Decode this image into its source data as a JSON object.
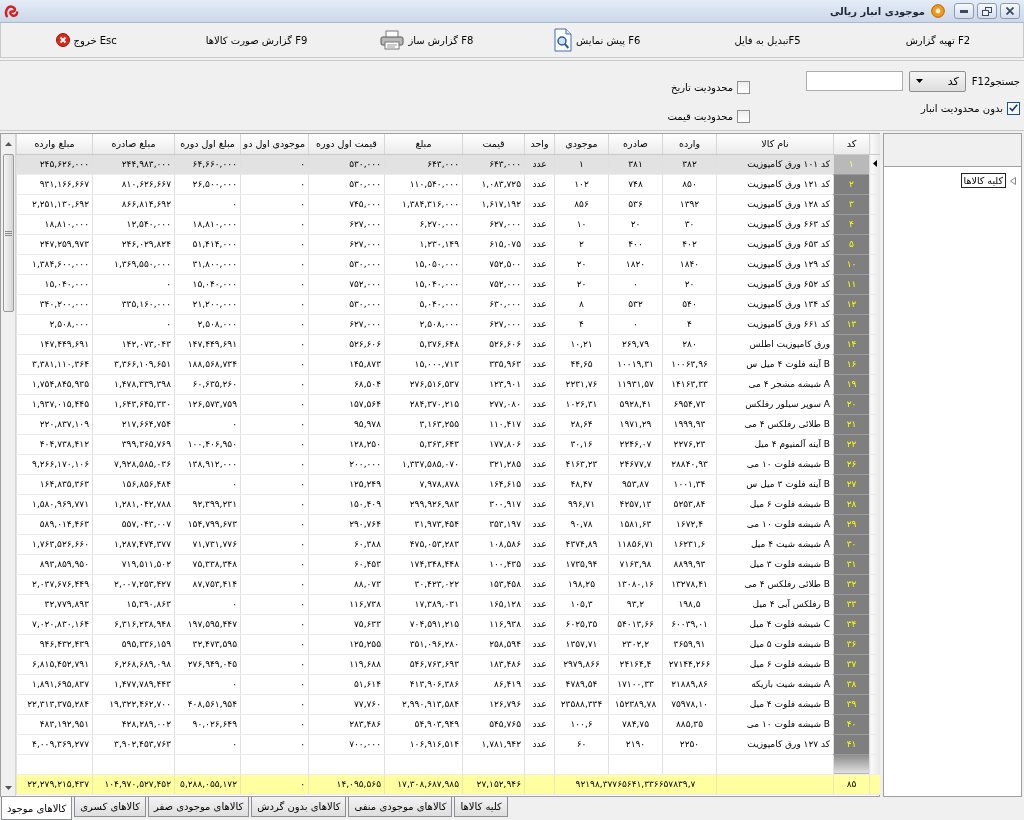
{
  "window": {
    "title": "موجودی انبار ریالی"
  },
  "toolbar": [
    {
      "label": "تهیه گزارش F2",
      "kind": "plain"
    },
    {
      "label": "تبدیل به فایلF5",
      "kind": "plain"
    },
    {
      "label": "پیش نمایش F6",
      "kind": "preview"
    },
    {
      "label": "گزارش ساز F8",
      "kind": "print"
    },
    {
      "label": "گزارش صورت کالاها F9",
      "kind": "plain"
    },
    {
      "label": "خروج Esc",
      "kind": "exit"
    }
  ],
  "filters": {
    "search": {
      "label": "F12جستجو",
      "field": "کد"
    },
    "warehouse": {
      "label": "بدون محدودیت انبار",
      "checked": true
    },
    "limits": [
      {
        "label": "محدودیت تاریخ",
        "checked": false
      },
      {
        "label": "محدودیت قیمت",
        "checked": false
      }
    ]
  },
  "table": {
    "columns": [
      "کد",
      "نام کالا",
      "وارده",
      "صادره",
      "موجودی",
      "واحد",
      "قیمت",
      "مبلغ",
      "قیمت اول دوره",
      "موجودی اول دو",
      "مبلغ اول دوره",
      "مبلغ صادره",
      "مبلغ وارده"
    ],
    "rows": [
      {
        "selected": true,
        "cells": [
          "۱",
          "کد ۱۰۱ ورق کامپوزیت",
          "۳۸۲",
          "۳۸۱",
          "۱",
          "عدد",
          "۶۴۳,۰۰۰",
          "۶۴۳,۰۰۰",
          "۵۳۰,۰۰۰",
          "۰",
          "۶۴,۶۶۰,۰۰۰",
          "۲۴۴,۹۸۳,۰۰۰",
          "۲۴۵,۶۲۶,۰۰۰"
        ]
      },
      {
        "selected": false,
        "cells": [
          "۲",
          "کد ۱۲۱ ورق کامپوزیت",
          "۸۵۰",
          "۷۴۸",
          "۱۰۲",
          "عدد",
          "۱,۰۸۳,۷۲۵",
          "۱۱۰,۵۴۰,۰۰۰",
          "۵۳۰,۰۰۰",
          "۰",
          "۲۶,۵۰۰,۰۰۰",
          "۸۱۰,۶۲۶,۶۶۷",
          "۹۳۱,۱۶۶,۶۶۷"
        ]
      },
      {
        "selected": false,
        "cells": [
          "۳",
          "کد ۱۲۸ ورق کامپوزیت",
          "۱۳۹۲",
          "۵۳۶",
          "۸۵۶",
          "عدد",
          "۱,۶۱۷,۱۹۲",
          "۱,۳۸۴,۳۱۶,۰۰۰",
          "۷۴۵,۰۰۰",
          "۰",
          "۰",
          "۸۶۶,۸۱۴,۶۹۲",
          "۲,۲۵۱,۱۳۰,۶۹۲"
        ]
      },
      {
        "selected": false,
        "cells": [
          "۴",
          "کد ۶۶۳ ورق کامپوزیت",
          "۳۰",
          "۲۰",
          "۱۰",
          "عدد",
          "۶۲۷,۰۰۰",
          "۶,۲۷۰,۰۰۰",
          "۶۲۷,۰۰۰",
          "۰",
          "۱۸,۸۱۰,۰۰۰",
          "۱۲,۵۴۰,۰۰۰",
          "۱۸,۸۱۰,۰۰۰"
        ]
      },
      {
        "selected": false,
        "cells": [
          "۵",
          "کد ۶۵۳ ورق کامپوزیت",
          "۴۰۲",
          "۴۰۰",
          "۲",
          "عدد",
          "۶۱۵,۰۷۵",
          "۱,۲۳۰,۱۴۹",
          "۶۲۷,۰۰۰",
          "۰",
          "۵۱,۴۱۴,۰۰۰",
          "۲۴۶,۰۲۹,۸۲۴",
          "۲۴۷,۲۵۹,۹۷۳"
        ]
      },
      {
        "selected": false,
        "cells": [
          "۱۰",
          "کد ۱۲۹ ورق کامپوزیت",
          "۱۸۴۰",
          "۱۸۲۰",
          "۲۰",
          "عدد",
          "۷۵۲,۵۰۰",
          "۱۵,۰۵۰,۰۰۰",
          "۵۳۰,۰۰۰",
          "۰",
          "۳۱,۸۰۰,۰۰۰",
          "۱,۳۶۹,۵۵۰,۰۰۰",
          "۱,۳۸۴,۶۰۰,۰۰۰"
        ]
      },
      {
        "selected": false,
        "cells": [
          "۱۱",
          "کد ۶۵۲ ورق کامپوزیت",
          "۲۰",
          "۰",
          "۲۰",
          "عدد",
          "۷۵۲,۰۰۰",
          "۱۵,۰۴۰,۰۰۰",
          "۷۵۲,۰۰۰",
          "۰",
          "۱۵,۰۴۰,۰۰۰",
          "۰",
          "۱۵,۰۴۰,۰۰۰"
        ]
      },
      {
        "selected": false,
        "cells": [
          "۱۲",
          "کد ۱۳۴ ورق کامپوزیت",
          "۵۴۰",
          "۵۳۲",
          "۸",
          "عدد",
          "۶۳۰,۰۰۰",
          "۵,۰۴۰,۰۰۰",
          "۵۳۰,۰۰۰",
          "۰",
          "۲۱,۲۰۰,۰۰۰",
          "۳۳۵,۱۶۰,۰۰۰",
          "۳۴۰,۲۰۰,۰۰۰"
        ]
      },
      {
        "selected": false,
        "cells": [
          "۱۳",
          "کد ۶۶۱ ورق کامپوزیت",
          "۴",
          "۰",
          "۴",
          "عدد",
          "۶۲۷,۰۰۰",
          "۲,۵۰۸,۰۰۰",
          "۶۲۷,۰۰۰",
          "۰",
          "۲,۵۰۸,۰۰۰",
          "۰",
          "۲,۵۰۸,۰۰۰"
        ]
      },
      {
        "selected": false,
        "cells": [
          "۱۴",
          "ورق کامپوزیت اطلس",
          "۲۸۰",
          "۲۶۹,۷۹",
          "۱۰,۲۱",
          "عدد",
          "۵۲۶,۶۰۶",
          "۵,۳۷۶,۶۴۸",
          "۵۲۶,۶۰۶",
          "۰",
          "۱۴۷,۴۴۹,۶۹۱",
          "۱۴۲,۰۷۳,۰۴۳",
          "۱۴۷,۴۴۹,۶۹۱"
        ]
      },
      {
        "selected": false,
        "cells": [
          "۱۶",
          "B آینه فلوت ۴ میل س",
          "۱۰۰۶۳,۹۶",
          "۱۰۰۱۹,۳۱",
          "۴۴,۶۵",
          "عدد",
          "۳۳۵,۹۶۳",
          "۱۵,۰۰۰,۷۱۳",
          "۱۴۵,۸۷۳",
          "۰",
          "۱۸۸,۵۶۸,۷۳۴",
          "۳,۳۶۶,۱۰۹,۶۵۱",
          "۳,۳۸۱,۱۱۰,۳۶۴"
        ]
      },
      {
        "selected": false,
        "cells": [
          "۱۹",
          "A شیشه مشجر ۴ می",
          "۱۴۱۶۳,۳۳",
          "۱۱۹۳۱,۵۷",
          "۲۲۳۱,۷۶",
          "عدد",
          "۱۲۳,۹۰۱",
          "۲۷۶,۵۱۶,۵۳۷",
          "۶۸,۵۰۴",
          "۰",
          "۶۰,۶۳۵,۲۶۰",
          "۱,۴۷۸,۳۳۹,۳۹۸",
          "۱,۷۵۴,۸۴۵,۹۳۵"
        ]
      },
      {
        "selected": false,
        "cells": [
          "۲۰",
          "A سوپر سیلور رفلکس",
          "۶۹۵۴,۷۳",
          "۵۹۲۸,۴۱",
          "۱۰۲۶,۳۱",
          "عدد",
          "۲۷۷,۰۸۰",
          "۲۸۴,۳۷۰,۲۱۵",
          "۱۵۷,۵۶۴",
          "۰",
          "۱۲۶,۵۷۳,۷۵۹",
          "۱,۶۴۳,۶۴۵,۳۳۰",
          "۱,۹۳۷,۰۱۵,۴۴۵"
        ]
      },
      {
        "selected": false,
        "cells": [
          "۲۱",
          "B طلائی رفلکس ۴ می",
          "۱۹۹۹,۹۳",
          "۱۹۷۱,۲۹",
          "۲۸,۶۴",
          "عدد",
          "۱۱۰,۴۱۷",
          "۳,۱۶۳,۲۵۵",
          "۹۵,۹۷۸",
          "۰",
          "۰",
          "۲۱۷,۶۶۴,۷۵۴",
          "۲۲۰,۸۳۷,۱۰۹"
        ]
      },
      {
        "selected": false,
        "cells": [
          "۲۲",
          "B آینه آلمنیوم ۴ میل",
          "۲۲۷۶,۲۳",
          "۲۲۴۶,۰۷",
          "۳۰,۱۶",
          "عدد",
          "۱۷۷,۸۰۶",
          "۵,۳۶۳,۶۴۳",
          "۱۲۸,۲۵۰",
          "۰",
          "۱۰۰,۴۰۶,۹۵۰",
          "۳۹۹,۳۶۵,۷۶۹",
          "۴۰۴,۷۳۸,۴۱۲"
        ]
      },
      {
        "selected": false,
        "cells": [
          "۲۶",
          "B شیشه فلوت ۱۰ می",
          "۲۸۸۴۰,۹۳",
          "۲۴۶۷۷,۷",
          "۴۱۶۳,۲۳",
          "عدد",
          "۳۲۱,۲۸۵",
          "۱,۳۳۷,۵۸۵,۰۷۰",
          "۲۰۰,۰۰۰",
          "۰",
          "۱۳۸,۹۱۲,۰۰۰",
          "۷,۹۲۸,۵۸۵,۰۳۶",
          "۹,۲۶۶,۱۷۰,۱۰۶"
        ]
      },
      {
        "selected": false,
        "cells": [
          "۲۷",
          "B آینه فلوت ۳ میل س",
          "۱۰۰۱,۳۴",
          "۹۵۳,۸۷",
          "۴۸,۴۷",
          "عدد",
          "۱۶۴,۶۱۵",
          "۷,۹۷۸,۸۷۸",
          "۱۲۵,۲۴۹",
          "۰",
          "۰",
          "۱۵۶,۸۵۶,۴۸۴",
          "۱۶۴,۸۳۵,۳۶۳"
        ]
      },
      {
        "selected": false,
        "cells": [
          "۲۸",
          "B شیشه فلوت ۶ میل",
          "۵۲۵۳,۸۴",
          "۴۲۵۷,۱۳",
          "۹۹۶,۷۱",
          "عدد",
          "۳۰۰,۹۱۷",
          "۲۹۹,۹۲۶,۹۸۳",
          "۱۵۰,۴۰۹",
          "۰",
          "۹۲,۳۹۹,۲۳۱",
          "۱,۲۸۱,۰۴۲,۷۸۸",
          "۱,۵۸۰,۹۶۹,۷۷۱"
        ]
      },
      {
        "selected": false,
        "cells": [
          "۲۹",
          "A شیشه فلوت ۱۰ می",
          "۱۶۷۲,۴",
          "۱۵۸۱,۶۳",
          "۹۰,۷۸",
          "عدد",
          "۳۵۳,۱۹۷",
          "۳۱,۹۷۳,۴۵۴",
          "۲۹۰,۷۶۴",
          "۰",
          "۱۵۴,۷۹۹,۶۷۳",
          "۵۵۷,۰۴۳,۰۰۷",
          "۵۸۹,۰۱۴,۴۶۳"
        ]
      },
      {
        "selected": false,
        "cells": [
          "۳۰",
          "A شیشه شیت ۴ میل",
          "۱۶۲۳۱,۶",
          "۱۱۸۵۶,۷۱",
          "۴۳۷۴,۸۹",
          "عدد",
          "۱۰۸,۵۸۶",
          "۴۷۵,۰۵۳,۲۸۳",
          "۶۰,۳۸۸",
          "۰",
          "۷۱,۷۳۱,۷۷۶",
          "۱,۲۸۷,۴۷۴,۳۷۷",
          "۱,۷۶۳,۵۲۶,۶۶۰"
        ]
      },
      {
        "selected": false,
        "cells": [
          "۳۱",
          "B شیشه فلوت ۳ میل",
          "۸۸۹۹,۹۳",
          "۷۱۶۳,۹۸",
          "۱۷۳۵,۹۴",
          "عدد",
          "۱۰۰,۴۳۵",
          "۱۷۴,۳۴۸,۴۴۸",
          "۶۰,۴۵۳",
          "۰",
          "۷۵,۳۳۸,۳۴۸",
          "۷۱۹,۵۱۱,۵۰۲",
          "۸۹۳,۸۵۹,۹۵۰"
        ]
      },
      {
        "selected": false,
        "cells": [
          "۳۲",
          "B طلائی رفلکس ۴ می",
          "۱۳۲۷۸,۴۱",
          "۱۳۰۸۰,۱۶",
          "۱۹۸,۲۵",
          "عدد",
          "۱۵۳,۴۵۸",
          "۳۰,۴۲۳,۰۲۲",
          "۸۸,۰۷۳",
          "۰",
          "۸۷,۷۵۳,۴۱۴",
          "۲,۰۰۷,۲۵۳,۴۲۷",
          "۲,۰۳۷,۶۷۶,۴۴۹"
        ]
      },
      {
        "selected": false,
        "cells": [
          "۳۳",
          "B رفلکس آبی ۴ میل",
          "۱۹۸,۵",
          "۹۳,۲",
          "۱۰۵,۳",
          "عدد",
          "۱۶۵,۱۲۸",
          "۱۷,۳۸۹,۰۳۱",
          "۱۱۶,۷۳۸",
          "۰",
          "۰",
          "۱۵,۳۹۰,۸۶۳",
          "۳۲,۷۷۹,۸۹۳"
        ]
      },
      {
        "selected": false,
        "cells": [
          "۳۴",
          "C شیشه فلوت ۴ میل",
          "۶۰۰۳۹,۰۱",
          "۵۴۰۱۳,۶۶",
          "۶۰۲۵,۳۵",
          "عدد",
          "۱۱۶,۹۳۸",
          "۷۰۴,۵۹۱,۲۱۵",
          "۷۵,۶۳۳",
          "۰",
          "۱۹۷,۵۹۵,۴۴۷",
          "۶,۳۱۶,۲۳۸,۹۴۸",
          "۷,۰۲۰,۸۳۰,۱۶۴"
        ]
      },
      {
        "selected": false,
        "cells": [
          "۳۶",
          "B شیشه فلوت ۵ میل",
          "۳۶۵۹,۹۱",
          "۲۳۰۲,۲",
          "۱۳۵۷,۷۱",
          "عدد",
          "۲۵۸,۵۹۴",
          "۳۵۱,۰۹۶,۲۸۰",
          "۱۲۵,۲۵۵",
          "۰",
          "۳۲,۴۷۳,۵۹۵",
          "۵۹۵,۳۳۶,۱۵۹",
          "۹۴۶,۴۳۲,۴۳۹"
        ]
      },
      {
        "selected": false,
        "cells": [
          "۳۷",
          "B شیشه فلوت ۶ میل",
          "۲۷۱۴۴,۲۶۶",
          "۲۴۱۶۴,۴",
          "۲۹۷۹,۸۶۶",
          "عدد",
          "۱۸۳,۴۸۶",
          "۵۴۶,۷۶۳,۶۹۳",
          "۱۱۹,۶۸۸",
          "۰",
          "۲۷۶,۹۴۹,۰۴۵",
          "۶,۲۶۸,۶۸۹,۰۹۸",
          "۶,۸۱۵,۴۵۲,۷۹۱"
        ]
      },
      {
        "selected": false,
        "cells": [
          "۳۸",
          "A شیشه شیت باریکه",
          "۲۱۸۸۹,۸۶",
          "۱۷۱۰۰,۳۳",
          "۴۷۸۹,۵۴",
          "عدد",
          "۸۶,۴۱۹",
          "۴۱۳,۹۰۶,۳۸۶",
          "۵۱,۶۱۴",
          "۰",
          "۰",
          "۱,۴۷۷,۷۸۹,۴۴۳",
          "۱,۸۹۱,۶۹۵,۸۳۷"
        ]
      },
      {
        "selected": false,
        "cells": [
          "۳۹",
          "B شیشه فلوت ۴ میل",
          "۷۵۹۷۸,۱۰",
          "۱۵۲۳۸۹,۷۸",
          "۲۳۵۸۸,۳۳۴",
          "عدد",
          "۱۲۶,۷۹۶",
          "۲,۹۹۰,۹۱۳,۵۸۴",
          "۷۷,۷۶۰",
          "۰",
          "۴۰۸,۵۶۱,۹۵۴",
          "۱۹,۳۲۲,۴۶۲,۷۰۰",
          "۲۲,۳۱۳,۳۷۵,۲۸۴"
        ]
      },
      {
        "selected": false,
        "cells": [
          "۴۰",
          "B شیشه فلوت ۱۰ می",
          "۸۸۵,۳۵",
          "۷۸۴,۷۵",
          "۱۰۰,۶",
          "عدد",
          "۵۴۵,۷۶۵",
          "۵۴,۹۰۳,۹۴۹",
          "۲۸۳,۴۸۶",
          "۰",
          "۹۰,۰۲۶,۶۴۹",
          "۴۲۸,۲۸۹,۰۰۲",
          "۴۸۳,۱۹۲,۹۵۱"
        ]
      },
      {
        "selected": false,
        "cells": [
          "۴۱",
          "کد ۱۲۷ ورق کامپوزیت",
          "۲۲۵۰",
          "۲۱۹۰",
          "۶۰",
          "عدد",
          "۱,۷۸۱,۹۴۲",
          "۱۰۶,۹۱۶,۵۱۴",
          "۷۰۰,۰۰۰",
          "۰",
          "۰",
          "۳,۹۰۲,۴۵۳,۷۶۳",
          "۴,۰۰۹,۳۶۹,۲۷۷"
        ]
      }
    ],
    "totals": {
      "code": "۸۵",
      "quantities": "۹۲۱۹۸,۳۷۷۶۵۶۴۱,۳۳۶۶۵۷۸۳۹,۷",
      "price": "۲۷,۱۵۲,۹۴۶",
      "amount": "۱۷,۳۰۸,۶۸۷,۹۸۵",
      "opening_price": "۱۴,۰۹۵,۵۶۵",
      "opening_stock": "۰",
      "opening_amount": "۵,۲۸۸,۰۵۵,۱۷۲",
      "issued_amount": "۱۰۴,۹۷۰,۵۲۷,۴۵۲",
      "received_amount": "۲۲,۲۷۹,۲۱۵,۴۳۷"
    }
  },
  "tree": {
    "items": [
      {
        "label": "کلیه کالاها",
        "selected": true,
        "expanded": false
      }
    ]
  },
  "tabs": [
    {
      "label": "کلیه کالاها",
      "selected": false
    },
    {
      "label": "کالاهای موجودی منفی",
      "selected": false
    },
    {
      "label": "کالاهای بدون گردش",
      "selected": false
    },
    {
      "label": "کالاهای موجودی صفر",
      "selected": false
    },
    {
      "label": "کالاهای کسری",
      "selected": false
    },
    {
      "label": "کالاهای موجود",
      "selected": true
    }
  ]
}
